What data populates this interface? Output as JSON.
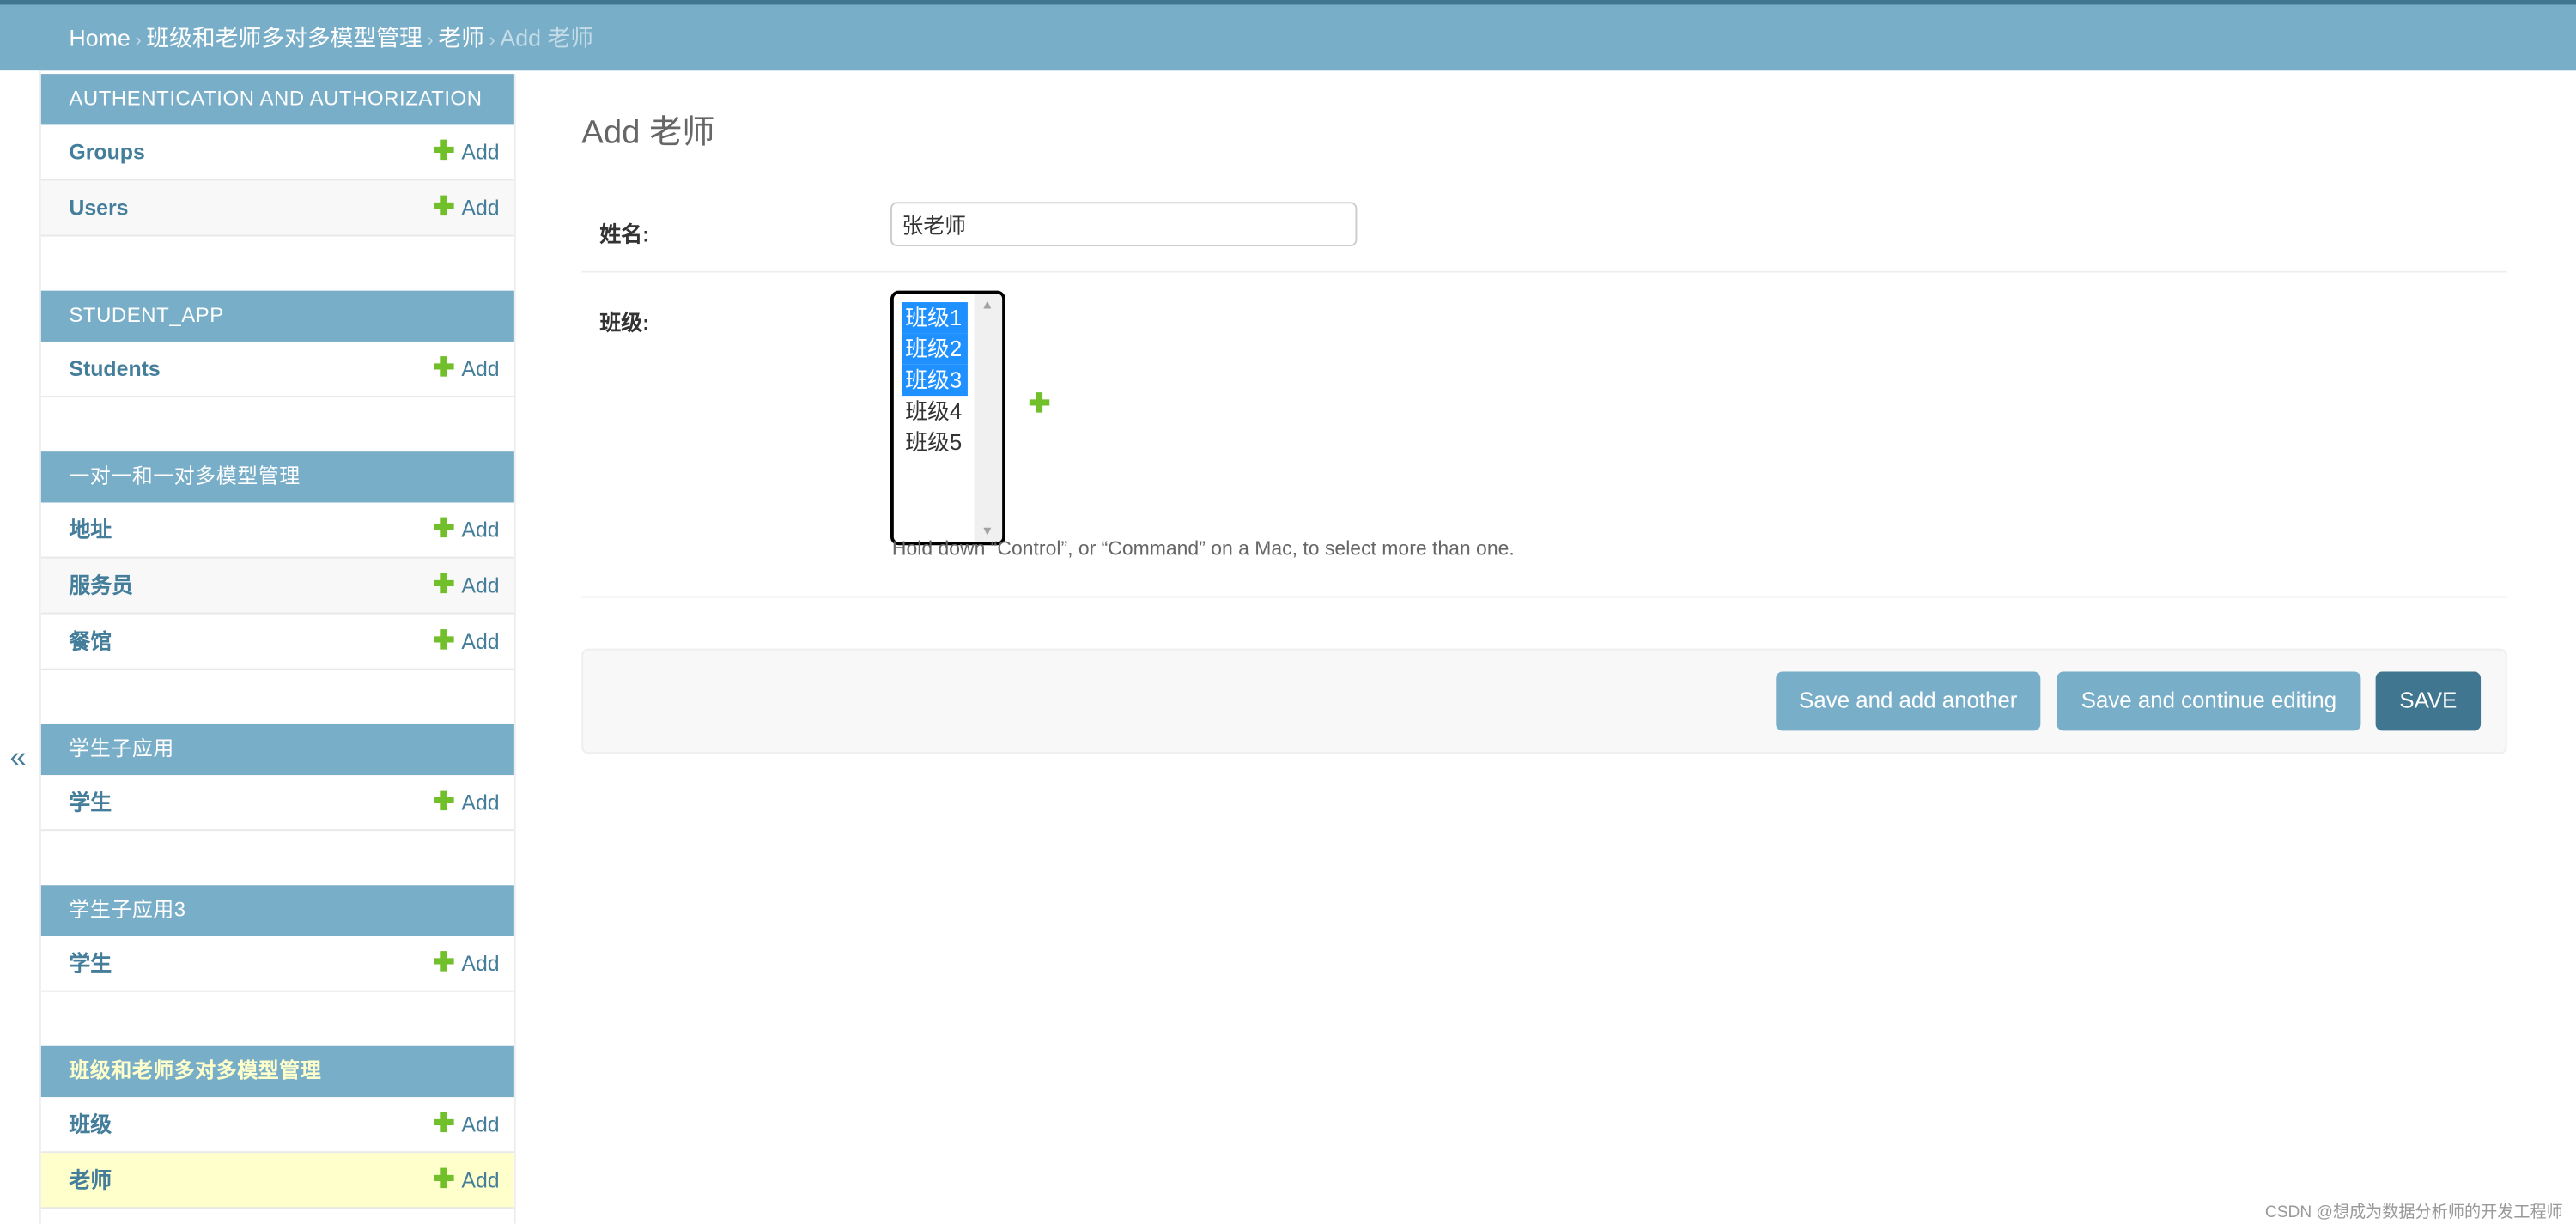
{
  "breadcrumbs": {
    "home": "Home",
    "app": "班级和老师多对多模型管理",
    "model": "老师",
    "current": "Add 老师",
    "separator": "›"
  },
  "sidebar": {
    "toggle": "«",
    "add_label": "Add",
    "modules": [
      {
        "caption": "AUTHENTICATION AND AUTHORIZATION",
        "items": [
          "Groups",
          "Users"
        ]
      },
      {
        "caption": "STUDENT_APP",
        "items": [
          "Students"
        ]
      },
      {
        "caption": "一对一和一对多模型管理",
        "items": [
          "地址",
          "服务员",
          "餐馆"
        ]
      },
      {
        "caption": "学生子应用",
        "items": [
          "学生"
        ]
      },
      {
        "caption": "学生子应用3",
        "items": [
          "学生"
        ]
      },
      {
        "caption": "班级和老师多对多模型管理",
        "items": [
          "班级",
          "老师"
        ]
      }
    ]
  },
  "page_title": "Add 老师",
  "form": {
    "name_label": "姓名:",
    "name_value": "张老师",
    "classes_label": "班级:",
    "classes_options": [
      "班级1",
      "班级2",
      "班级3",
      "班级4",
      "班级5"
    ],
    "classes_selected": [
      "班级1",
      "班级2",
      "班级3"
    ],
    "help_text": "Hold down “Control”, or “Command” on a Mac, to select more than one."
  },
  "buttons": {
    "save_add": "Save and add another",
    "save_continue": "Save and continue editing",
    "save": "SAVE"
  },
  "watermark": "CSDN @想成为数据分析师的开发工程师",
  "colors": {
    "header": "#79aec8",
    "primary": "#417690",
    "add_green": "#70bf2b",
    "selected_option": "#1e90ff",
    "current_row": "#ffffcc"
  }
}
